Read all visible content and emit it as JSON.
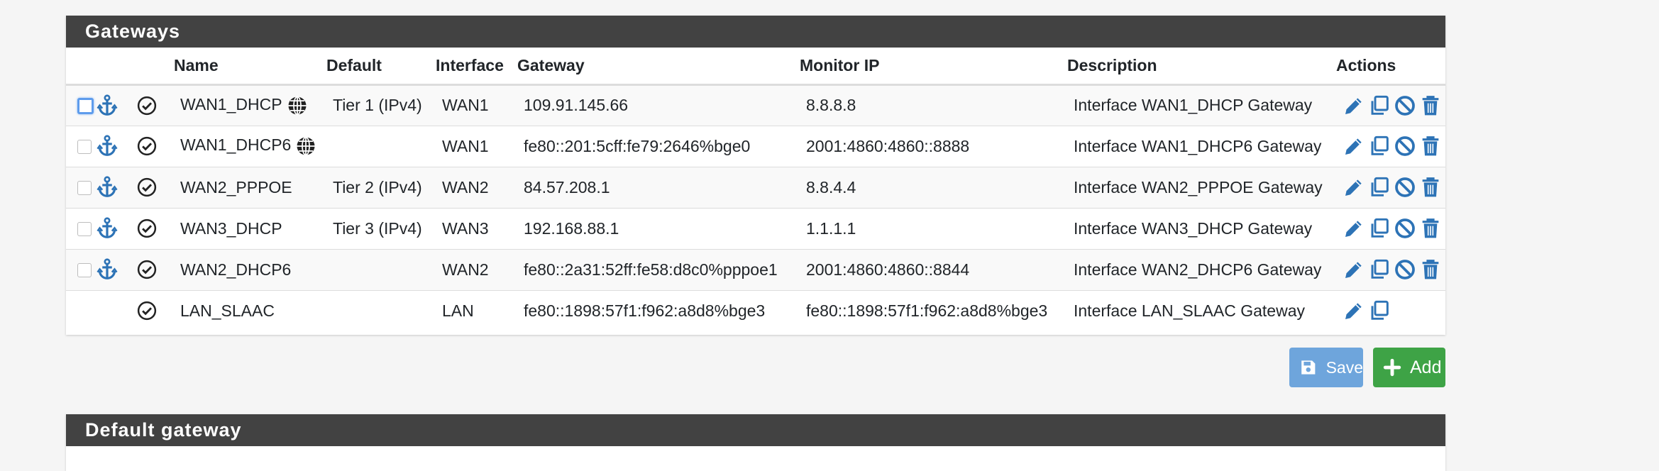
{
  "gateways_panel": {
    "title": "Gateways",
    "columns": [
      "Name",
      "Default",
      "Interface",
      "Gateway",
      "Monitor IP",
      "Description",
      "Actions"
    ],
    "rows": [
      {
        "name": "WAN1_DHCP",
        "default": "Tier 1 (IPv4)",
        "interface": "WAN1",
        "gateway": "109.91.145.66",
        "monitor_ip": "8.8.8.8",
        "description": "Interface WAN1_DHCP Gateway"
      },
      {
        "name": "WAN1_DHCP6",
        "default": "",
        "interface": "WAN1",
        "gateway": "fe80::201:5cff:fe79:2646%bge0",
        "monitor_ip": "2001:4860:4860::8888",
        "description": "Interface WAN1_DHCP6 Gateway"
      },
      {
        "name": "WAN2_PPPOE",
        "default": "Tier 2 (IPv4)",
        "interface": "WAN2",
        "gateway": "84.57.208.1",
        "monitor_ip": "8.8.4.4",
        "description": "Interface WAN2_PPPOE Gateway"
      },
      {
        "name": "WAN3_DHCP",
        "default": "Tier 3 (IPv4)",
        "interface": "WAN3",
        "gateway": "192.168.88.1",
        "monitor_ip": "1.1.1.1",
        "description": "Interface WAN3_DHCP Gateway"
      },
      {
        "name": "WAN2_DHCP6",
        "default": "",
        "interface": "WAN2",
        "gateway": "fe80::2a31:52ff:fe58:d8c0%pppoe1",
        "monitor_ip": "2001:4860:4860::8844",
        "description": "Interface WAN2_DHCP6 Gateway"
      },
      {
        "name": "LAN_SLAAC",
        "default": "",
        "interface": "LAN",
        "gateway": "fe80::1898:57f1:f962:a8d8%bge3",
        "monitor_ip": "fe80::1898:57f1:f962:a8d8%bge3",
        "description": "Interface LAN_SLAAC Gateway"
      }
    ]
  },
  "buttons": {
    "save_label": "Save",
    "add_label": "Add"
  },
  "default_gateway_panel": {
    "title": "Default gateway"
  },
  "icons": {
    "anchor": "anchor-icon",
    "status": "check-circle-icon",
    "globe": "globe-icon",
    "edit": "pencil-icon",
    "copy": "copy-icon",
    "disable": "ban-icon",
    "delete": "trash-icon",
    "save": "floppy-icon",
    "add": "plus-icon"
  },
  "colors": {
    "heading_bg": "#424242",
    "icon_blue": "#2d73b6",
    "save_bg": "#6ea5dc",
    "add_bg": "#3ea346"
  }
}
